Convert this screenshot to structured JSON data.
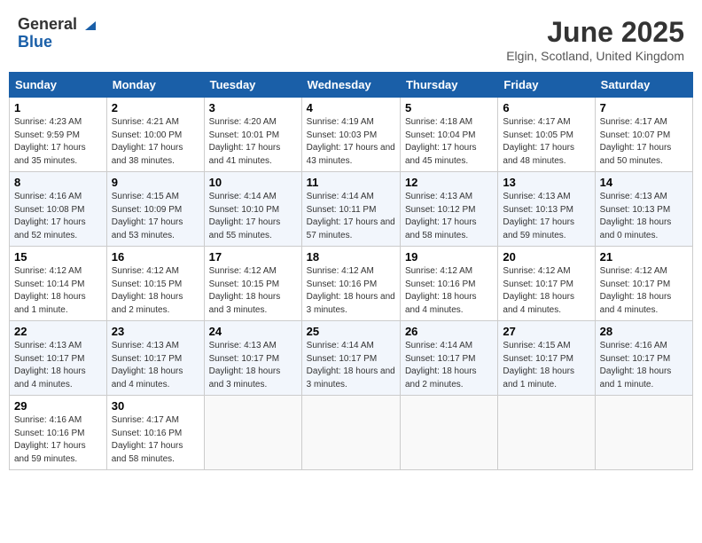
{
  "logo": {
    "line1": "General",
    "line2": "Blue"
  },
  "title": "June 2025",
  "location": "Elgin, Scotland, United Kingdom",
  "weekdays": [
    "Sunday",
    "Monday",
    "Tuesday",
    "Wednesday",
    "Thursday",
    "Friday",
    "Saturday"
  ],
  "weeks": [
    [
      {
        "day": "1",
        "sunrise": "Sunrise: 4:23 AM",
        "sunset": "Sunset: 9:59 PM",
        "daylight": "Daylight: 17 hours and 35 minutes."
      },
      {
        "day": "2",
        "sunrise": "Sunrise: 4:21 AM",
        "sunset": "Sunset: 10:00 PM",
        "daylight": "Daylight: 17 hours and 38 minutes."
      },
      {
        "day": "3",
        "sunrise": "Sunrise: 4:20 AM",
        "sunset": "Sunset: 10:01 PM",
        "daylight": "Daylight: 17 hours and 41 minutes."
      },
      {
        "day": "4",
        "sunrise": "Sunrise: 4:19 AM",
        "sunset": "Sunset: 10:03 PM",
        "daylight": "Daylight: 17 hours and 43 minutes."
      },
      {
        "day": "5",
        "sunrise": "Sunrise: 4:18 AM",
        "sunset": "Sunset: 10:04 PM",
        "daylight": "Daylight: 17 hours and 45 minutes."
      },
      {
        "day": "6",
        "sunrise": "Sunrise: 4:17 AM",
        "sunset": "Sunset: 10:05 PM",
        "daylight": "Daylight: 17 hours and 48 minutes."
      },
      {
        "day": "7",
        "sunrise": "Sunrise: 4:17 AM",
        "sunset": "Sunset: 10:07 PM",
        "daylight": "Daylight: 17 hours and 50 minutes."
      }
    ],
    [
      {
        "day": "8",
        "sunrise": "Sunrise: 4:16 AM",
        "sunset": "Sunset: 10:08 PM",
        "daylight": "Daylight: 17 hours and 52 minutes."
      },
      {
        "day": "9",
        "sunrise": "Sunrise: 4:15 AM",
        "sunset": "Sunset: 10:09 PM",
        "daylight": "Daylight: 17 hours and 53 minutes."
      },
      {
        "day": "10",
        "sunrise": "Sunrise: 4:14 AM",
        "sunset": "Sunset: 10:10 PM",
        "daylight": "Daylight: 17 hours and 55 minutes."
      },
      {
        "day": "11",
        "sunrise": "Sunrise: 4:14 AM",
        "sunset": "Sunset: 10:11 PM",
        "daylight": "Daylight: 17 hours and 57 minutes."
      },
      {
        "day": "12",
        "sunrise": "Sunrise: 4:13 AM",
        "sunset": "Sunset: 10:12 PM",
        "daylight": "Daylight: 17 hours and 58 minutes."
      },
      {
        "day": "13",
        "sunrise": "Sunrise: 4:13 AM",
        "sunset": "Sunset: 10:13 PM",
        "daylight": "Daylight: 17 hours and 59 minutes."
      },
      {
        "day": "14",
        "sunrise": "Sunrise: 4:13 AM",
        "sunset": "Sunset: 10:13 PM",
        "daylight": "Daylight: 18 hours and 0 minutes."
      }
    ],
    [
      {
        "day": "15",
        "sunrise": "Sunrise: 4:12 AM",
        "sunset": "Sunset: 10:14 PM",
        "daylight": "Daylight: 18 hours and 1 minute."
      },
      {
        "day": "16",
        "sunrise": "Sunrise: 4:12 AM",
        "sunset": "Sunset: 10:15 PM",
        "daylight": "Daylight: 18 hours and 2 minutes."
      },
      {
        "day": "17",
        "sunrise": "Sunrise: 4:12 AM",
        "sunset": "Sunset: 10:15 PM",
        "daylight": "Daylight: 18 hours and 3 minutes."
      },
      {
        "day": "18",
        "sunrise": "Sunrise: 4:12 AM",
        "sunset": "Sunset: 10:16 PM",
        "daylight": "Daylight: 18 hours and 3 minutes."
      },
      {
        "day": "19",
        "sunrise": "Sunrise: 4:12 AM",
        "sunset": "Sunset: 10:16 PM",
        "daylight": "Daylight: 18 hours and 4 minutes."
      },
      {
        "day": "20",
        "sunrise": "Sunrise: 4:12 AM",
        "sunset": "Sunset: 10:17 PM",
        "daylight": "Daylight: 18 hours and 4 minutes."
      },
      {
        "day": "21",
        "sunrise": "Sunrise: 4:12 AM",
        "sunset": "Sunset: 10:17 PM",
        "daylight": "Daylight: 18 hours and 4 minutes."
      }
    ],
    [
      {
        "day": "22",
        "sunrise": "Sunrise: 4:13 AM",
        "sunset": "Sunset: 10:17 PM",
        "daylight": "Daylight: 18 hours and 4 minutes."
      },
      {
        "day": "23",
        "sunrise": "Sunrise: 4:13 AM",
        "sunset": "Sunset: 10:17 PM",
        "daylight": "Daylight: 18 hours and 4 minutes."
      },
      {
        "day": "24",
        "sunrise": "Sunrise: 4:13 AM",
        "sunset": "Sunset: 10:17 PM",
        "daylight": "Daylight: 18 hours and 3 minutes."
      },
      {
        "day": "25",
        "sunrise": "Sunrise: 4:14 AM",
        "sunset": "Sunset: 10:17 PM",
        "daylight": "Daylight: 18 hours and 3 minutes."
      },
      {
        "day": "26",
        "sunrise": "Sunrise: 4:14 AM",
        "sunset": "Sunset: 10:17 PM",
        "daylight": "Daylight: 18 hours and 2 minutes."
      },
      {
        "day": "27",
        "sunrise": "Sunrise: 4:15 AM",
        "sunset": "Sunset: 10:17 PM",
        "daylight": "Daylight: 18 hours and 1 minute."
      },
      {
        "day": "28",
        "sunrise": "Sunrise: 4:16 AM",
        "sunset": "Sunset: 10:17 PM",
        "daylight": "Daylight: 18 hours and 1 minute."
      }
    ],
    [
      {
        "day": "29",
        "sunrise": "Sunrise: 4:16 AM",
        "sunset": "Sunset: 10:16 PM",
        "daylight": "Daylight: 17 hours and 59 minutes."
      },
      {
        "day": "30",
        "sunrise": "Sunrise: 4:17 AM",
        "sunset": "Sunset: 10:16 PM",
        "daylight": "Daylight: 17 hours and 58 minutes."
      },
      null,
      null,
      null,
      null,
      null
    ]
  ]
}
